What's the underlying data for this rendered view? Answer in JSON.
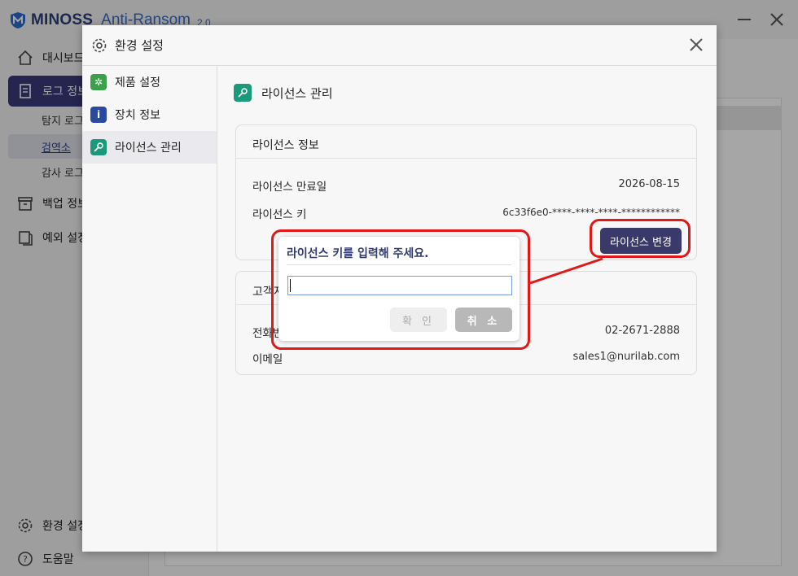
{
  "app": {
    "name": "MINOSS",
    "subtitle": "Anti-Ransom",
    "version": "2.0"
  },
  "sidebar": {
    "items": [
      {
        "label": "대시보드",
        "icon": "home-icon"
      },
      {
        "label": "로그 정보",
        "icon": "log-icon",
        "active": true
      },
      {
        "label": "탐지 로그",
        "sub": true
      },
      {
        "label": "검역소",
        "sub": true,
        "selected": true
      },
      {
        "label": "감사 로그",
        "sub": true
      },
      {
        "label": "백업 정보",
        "icon": "archive-icon"
      },
      {
        "label": "예외 설정",
        "icon": "exception-icon"
      }
    ],
    "bottom": [
      {
        "label": "환경 설정",
        "icon": "gear-icon"
      },
      {
        "label": "도움말",
        "icon": "help-icon"
      }
    ]
  },
  "settings": {
    "title": "환경 설정",
    "nav": [
      {
        "label": "제품 설정",
        "icon": "gear-icon",
        "color": "#3aa04a"
      },
      {
        "label": "장치 정보",
        "icon": "info-icon",
        "color": "#2a4aa0"
      },
      {
        "label": "라이선스 관리",
        "icon": "key-icon",
        "color": "#1a9a7a",
        "active": true
      }
    ],
    "page_title": "라이선스 관리",
    "license_card": {
      "title": "라이선스 정보",
      "expiry_label": "라이선스 만료일",
      "expiry_value": "2026-08-15",
      "key_label": "라이선스 키",
      "key_value": "6c33f6e0-****-****-****-************",
      "change_button": "라이선스 변경"
    },
    "support_card": {
      "title": "고객지원",
      "phone_label": "전화번호",
      "phone_value": "02-2671-2888",
      "email_label": "이메일",
      "email_value": "sales1@nurilab.com"
    }
  },
  "prompt": {
    "title": "라이선스 키를 입력해 주세요.",
    "input_value": "",
    "ok": "확 인",
    "cancel": "취 소"
  },
  "colors": {
    "accent": "#3a3a7a",
    "highlight": "#e01818",
    "key_green": "#1a9a7a"
  }
}
